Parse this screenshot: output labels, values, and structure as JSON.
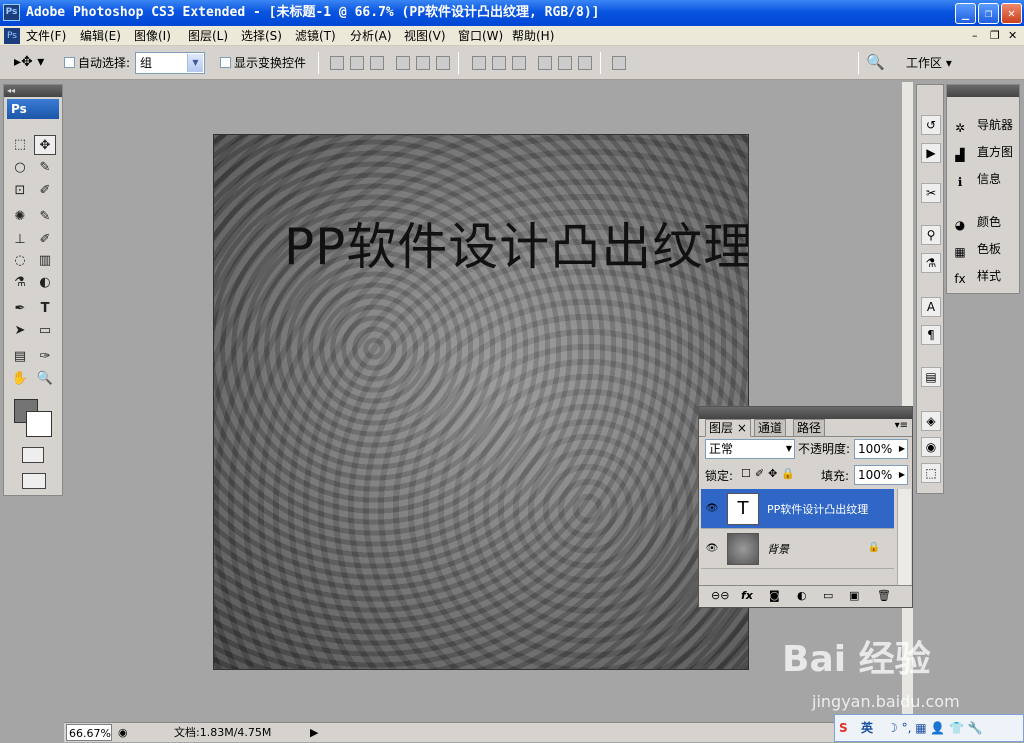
{
  "window": {
    "title": "Adobe Photoshop CS3 Extended - [未标题-1 @ 66.7% (PP软件设计凸出纹理, RGB/8)]",
    "app_icon": "Ps",
    "controls": {
      "minimize": "_",
      "restore": "❐",
      "close": "✕"
    }
  },
  "menu": {
    "items": [
      "文件(F)",
      "编辑(E)",
      "图像(I)",
      "图层(L)",
      "选择(S)",
      "滤镜(T)",
      "分析(A)",
      "视图(V)",
      "窗口(W)",
      "帮助(H)"
    ],
    "doc_controls": {
      "minimize": "–",
      "restore": "❐",
      "close": "✕"
    }
  },
  "options": {
    "auto_select_label": "自动选择:",
    "auto_select_value": "组",
    "show_transform_label": "显示变换控件",
    "workspace_label": "工作区 ▾"
  },
  "toolbox": {
    "brand": "Ps",
    "collapse": "◂◂",
    "tools": [
      "⬚",
      "✥",
      "○",
      "✎",
      "⊡",
      "✐",
      "✺",
      "✎",
      "⊥",
      "✐",
      "◌",
      "▥",
      "⚗",
      "◐",
      "✒",
      "T",
      "➤",
      "▭",
      "▤",
      "✑",
      "✋",
      "🔍"
    ]
  },
  "document": {
    "text_layer": "PP软件设计凸出纹理"
  },
  "status": {
    "zoom": "66.67%",
    "doc_info": "文档:1.83M/4.75M"
  },
  "right_panel": {
    "items": [
      {
        "icon": "navigator-icon",
        "glyph": "✲",
        "label": "导航器"
      },
      {
        "icon": "histogram-icon",
        "glyph": "▟",
        "label": "直方图"
      },
      {
        "icon": "info-icon",
        "glyph": "ℹ",
        "label": "信息"
      },
      {
        "icon": "color-icon",
        "glyph": "◕",
        "label": "颜色"
      },
      {
        "icon": "swatches-icon",
        "glyph": "▦",
        "label": "色板"
      },
      {
        "icon": "styles-icon",
        "glyph": "fx",
        "label": "样式"
      }
    ]
  },
  "layers_panel": {
    "tabs": [
      "图层 ×",
      "通道",
      "路径"
    ],
    "blend_mode": "正常",
    "opacity_label": "不透明度:",
    "opacity_value": "100%",
    "lock_label": "锁定:",
    "fill_label": "填充:",
    "fill_value": "100%",
    "layers": [
      {
        "name": "PP软件设计凸出纹理",
        "thumb": "T",
        "active": true
      },
      {
        "name": "背景",
        "thumb": "",
        "active": false,
        "locked": "🔒"
      }
    ],
    "footer": [
      "⊖⊖",
      "fx",
      "◙",
      "◐",
      "▭",
      "▣",
      "🗑"
    ]
  },
  "watermark": {
    "brand": "Bai 经验",
    "url": "jingyan.baidu.com"
  },
  "tray": {
    "ime": "S",
    "lang": "英",
    "icons": "☽ °, ▦ 👤 👕 🔧"
  }
}
